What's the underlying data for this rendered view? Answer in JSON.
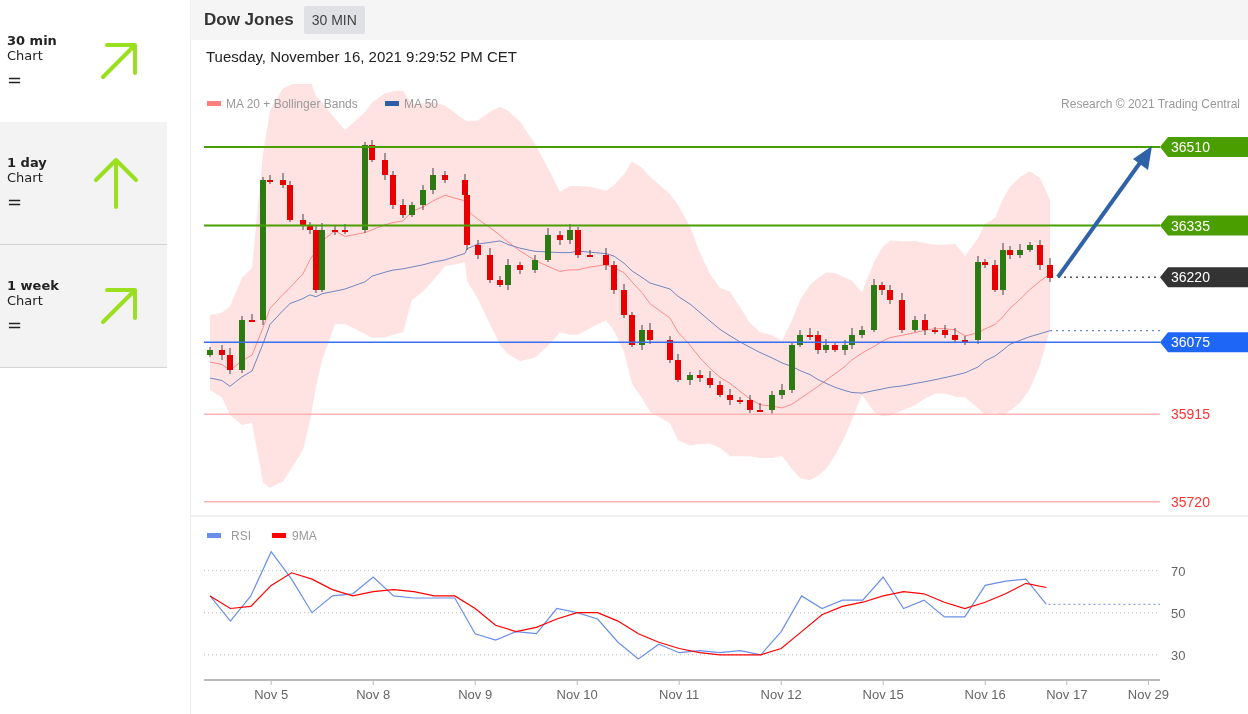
{
  "sidebar": {
    "items": [
      {
        "timeframe": "30 min",
        "caption": "Chart",
        "symbol": "=",
        "kind": "up-right",
        "selected": true
      },
      {
        "timeframe": "1 day",
        "caption": "Chart",
        "symbol": "=",
        "kind": "up",
        "selected": false
      },
      {
        "timeframe": "1 week",
        "caption": "Chart",
        "symbol": "=",
        "kind": "up-right",
        "selected": false
      }
    ]
  },
  "header": {
    "title": "Dow Jones",
    "interval": "30 MIN"
  },
  "timestamp": "Tuesday, November 16, 2021 9:29:52 PM CET",
  "price_chart": {
    "legend": [
      {
        "label": "MA 20 + Bollinger Bands",
        "color": "#ff7f7f"
      },
      {
        "label": "MA 50",
        "color": "#2e5ea8"
      }
    ],
    "credit": "Research © 2021 Trading Central",
    "levels": [
      {
        "kind": "resistance",
        "value": "36510"
      },
      {
        "kind": "resistance",
        "value": "36335"
      },
      {
        "kind": "current",
        "value": "36220"
      },
      {
        "kind": "pivot",
        "value": "36075"
      },
      {
        "kind": "support",
        "value": "35915"
      },
      {
        "kind": "support",
        "value": "35720"
      }
    ]
  },
  "rsi_panel": {
    "chart_data": {
      "type": "line",
      "categories": [
        null,
        null,
        null,
        "Nov 5",
        null,
        null,
        null,
        null,
        "Nov 8",
        null,
        null,
        null,
        null,
        "Nov 9",
        null,
        null,
        null,
        null,
        "Nov 10",
        null,
        null,
        null,
        null,
        "Nov 11",
        null,
        null,
        null,
        null,
        "Nov 12",
        null,
        null,
        null,
        null,
        "Nov 15",
        null,
        null,
        null,
        null,
        "Nov 16",
        null,
        null,
        null,
        "Nov 17",
        null,
        null,
        null,
        "Nov 29"
      ],
      "series": [
        {
          "name": "RSI",
          "color": "#6b8fe8",
          "values": [
            58,
            46,
            58,
            79,
            66,
            50,
            58,
            59,
            67,
            58,
            57,
            57,
            57,
            40,
            37,
            41,
            40,
            52,
            50,
            47,
            36,
            28,
            35,
            31,
            32,
            31,
            32,
            30,
            41,
            58,
            52,
            56,
            56,
            67,
            52,
            56,
            48,
            48,
            63,
            65,
            66,
            54,
            null,
            null,
            null,
            null,
            null
          ]
        },
        {
          "name": "9MA",
          "color": "#ff0000",
          "values": [
            58,
            52,
            53,
            63,
            69,
            66,
            61,
            58,
            60,
            61,
            60,
            58,
            58,
            52,
            44,
            41,
            43,
            47,
            50,
            50,
            46,
            40,
            36,
            33,
            31,
            30,
            30,
            30,
            33,
            41,
            49,
            53,
            55,
            58,
            60,
            59,
            55,
            52,
            55,
            59,
            64,
            62,
            null,
            null,
            null,
            null,
            null
          ]
        }
      ],
      "grid": true,
      "ylim": [
        18,
        96
      ],
      "yticks": [
        30,
        50,
        70
      ]
    }
  }
}
